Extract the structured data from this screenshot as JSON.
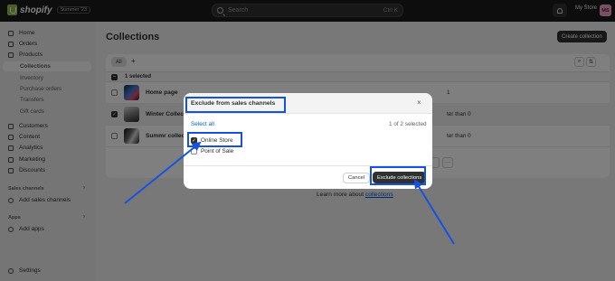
{
  "topbar": {
    "logo": "shopify",
    "edition": "Summer '23",
    "search_placeholder": "Search",
    "search_shortcut": "Ctrl K",
    "store_name": "My Store",
    "avatar_initials": "MS"
  },
  "sidebar": {
    "items": [
      {
        "label": "Home"
      },
      {
        "label": "Orders"
      },
      {
        "label": "Products"
      },
      {
        "label": "Collections"
      },
      {
        "label": "Inventory"
      },
      {
        "label": "Purchase orders"
      },
      {
        "label": "Transfers"
      },
      {
        "label": "Gift cards"
      },
      {
        "label": "Customers"
      },
      {
        "label": "Content"
      },
      {
        "label": "Analytics"
      },
      {
        "label": "Marketing"
      },
      {
        "label": "Discounts"
      }
    ],
    "sales_channels_heading": "Sales channels",
    "add_sales_channels": "Add sales channels",
    "apps_heading": "Apps",
    "add_apps": "Add apps",
    "settings": "Settings",
    "chevron": "›"
  },
  "main": {
    "title": "Collections",
    "create_button": "Create collection",
    "filter_tab": "All",
    "add_filter": "+",
    "selected_text": "1 selected",
    "rows": [
      {
        "name": "Home page",
        "condition": "1"
      },
      {
        "name": "Winter Collecti",
        "condition": "ter than 0"
      },
      {
        "name": "Summr collecti",
        "condition": "ter than 0"
      }
    ],
    "more_actions": "···",
    "learn_more_prefix": "Learn more about ",
    "learn_more_link": "collections"
  },
  "modal": {
    "title": "Exclude from sales channels",
    "close": "×",
    "select_all": "Select all",
    "selected_count": "1 of 2 selected",
    "options": [
      {
        "label": "Online Store",
        "checked": true
      },
      {
        "label": "Point of Sale",
        "checked": false
      }
    ],
    "cancel": "Cancel",
    "exclude": "Exclude collections"
  },
  "colors": {
    "highlight": "#1652e0",
    "topbar": "#1a1a1a",
    "link": "#005bd3"
  }
}
